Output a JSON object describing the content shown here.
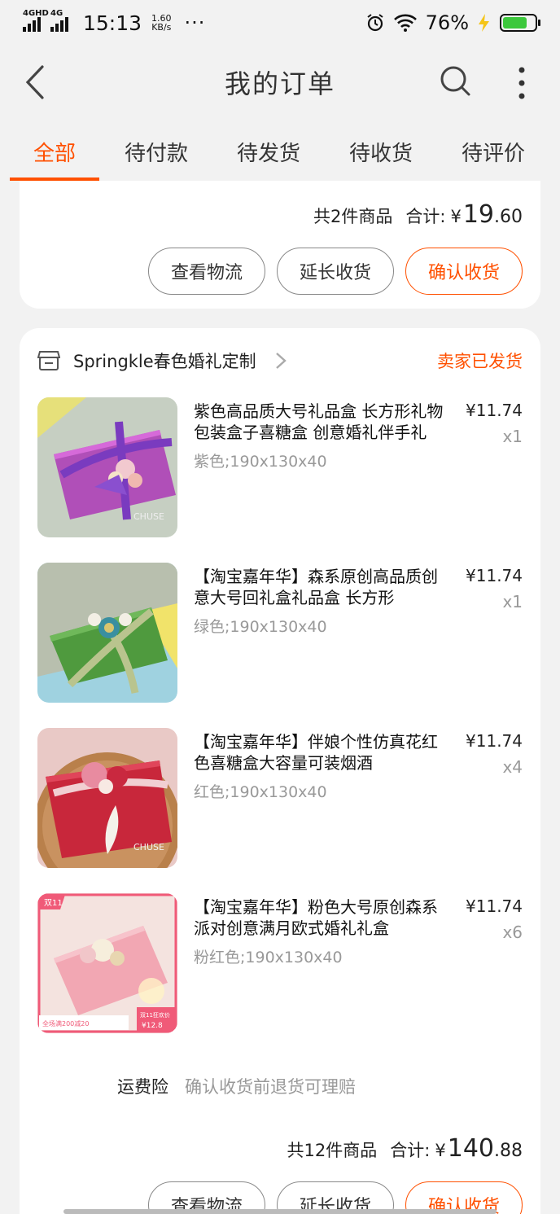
{
  "status_bar": {
    "net1": "4GHD",
    "net2": "4G",
    "time": "15:13",
    "speed_value": "1.60",
    "speed_unit": "KB/s",
    "dots": "···",
    "battery_pct_text": "76%",
    "battery_level": 0.76
  },
  "nav": {
    "title": "我的订单"
  },
  "tabs": [
    {
      "label": "全部",
      "active": true
    },
    {
      "label": "待付款"
    },
    {
      "label": "待发货"
    },
    {
      "label": "待收货"
    },
    {
      "label": "待评价"
    }
  ],
  "order1": {
    "count_text": "共2件商品",
    "total_label": "合计:",
    "currency": "¥",
    "total_int": "19",
    "total_dec": ".60",
    "buttons": [
      "查看物流",
      "延长收货",
      "确认收货"
    ]
  },
  "order2": {
    "shop_name": "Springkle春色婚礼定制",
    "status": "卖家已发货",
    "items": [
      {
        "title": "紫色高品质大号礼品盒 长方形礼物包装盒子喜糖盒 创意婚礼伴手礼",
        "spec": "紫色;190x130x40",
        "price": "¥11.74",
        "qty": "x1",
        "thumb_label": "CHUSE"
      },
      {
        "title": "【淘宝嘉年华】森系原创高品质创意大号回礼盒礼品盒 长方形",
        "spec": "绿色;190x130x40",
        "price": "¥11.74",
        "qty": "x1"
      },
      {
        "title": "【淘宝嘉年华】伴娘个性仿真花红色喜糖盒大容量可装烟酒",
        "spec": "红色;190x130x40",
        "price": "¥11.74",
        "qty": "x4",
        "thumb_label": "CHUSE"
      },
      {
        "title": "【淘宝嘉年华】粉色大号原创森系派对创意满月欧式婚礼礼盒",
        "spec": "粉红色;190x130x40",
        "price": "¥11.74",
        "qty": "x6",
        "thumb_badge": "双11",
        "thumb_promo": "全场满200减20",
        "thumb_promo_sub": "双11狂欢价",
        "thumb_price": "¥12.8"
      }
    ],
    "insurance_label": "运费险",
    "insurance_desc": "确认收货前退货可理赔",
    "count_text": "共12件商品",
    "total_label": "合计:",
    "currency": "¥",
    "total_int": "140",
    "total_dec": ".88",
    "buttons": [
      "查看物流",
      "延长收货",
      "确认收货"
    ]
  },
  "colors": {
    "accent": "#ff5000",
    "background": "#f2f2f2",
    "card": "#ffffff",
    "muted_text": "#999999"
  }
}
